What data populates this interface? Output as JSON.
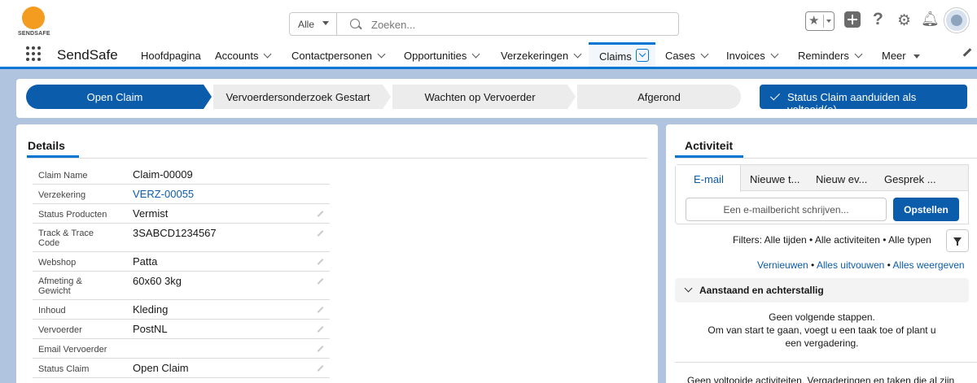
{
  "header": {
    "logo_text": "SENDSAFE",
    "search_scope": "Alle",
    "search_placeholder": "Zoeken..."
  },
  "nav": {
    "app_name": "SendSafe",
    "items": [
      {
        "label": "Hoofdpagina",
        "menu": false
      },
      {
        "label": "Accounts",
        "menu": true
      },
      {
        "label": "Contactpersonen",
        "menu": true
      },
      {
        "label": "Opportunities",
        "menu": true
      },
      {
        "label": "Verzekeringen",
        "menu": true
      },
      {
        "label": "Claims",
        "menu": true,
        "active": true
      },
      {
        "label": "Cases",
        "menu": true
      },
      {
        "label": "Invoices",
        "menu": true
      },
      {
        "label": "Reminders",
        "menu": true
      },
      {
        "label": "Meer",
        "menu": true
      }
    ]
  },
  "path": {
    "steps": [
      "Open Claim",
      "Vervoerdersonderzoek Gestart",
      "Wachten op Vervoerder",
      "Afgerond"
    ],
    "current_index": 0,
    "mark_button": "Status Claim aanduiden als voltooid(e)"
  },
  "details": {
    "tab": "Details",
    "fields": [
      {
        "label": "Claim Name",
        "value": "Claim-00009",
        "editable": false,
        "link": false
      },
      {
        "label": "Verzekering",
        "value": "VERZ-00055",
        "editable": false,
        "link": true
      },
      {
        "label": "Status Producten",
        "value": "Vermist",
        "editable": true,
        "link": false
      },
      {
        "label": "Track & Trace Code",
        "value": "3SABCD1234567",
        "editable": true,
        "link": false
      },
      {
        "label": "Webshop",
        "value": "Patta",
        "editable": true,
        "link": false
      },
      {
        "label": "Afmeting & Gewicht",
        "value": "60x60 3kg",
        "editable": true,
        "link": false
      },
      {
        "label": "Inhoud",
        "value": "Kleding",
        "editable": true,
        "link": false
      },
      {
        "label": "Vervoerder",
        "value": "PostNL",
        "editable": true,
        "link": false
      },
      {
        "label": "Email Vervoerder",
        "value": "",
        "editable": true,
        "link": false
      },
      {
        "label": "Status Claim",
        "value": "Open Claim",
        "editable": true,
        "link": false
      }
    ]
  },
  "activity": {
    "title": "Activiteit",
    "tabs": [
      "E-mail",
      "Nieuwe t...",
      "Nieuw ev...",
      "Gesprek ..."
    ],
    "email_placeholder": "Een e-mailbericht schrijven...",
    "compose_button": "Opstellen",
    "filters": "Filters: Alle tijden • Alle activiteiten • Alle typen",
    "links": [
      "Vernieuwen",
      "Alles uitvouwen",
      "Alles weergeven"
    ],
    "link_sep": " • ",
    "section_title": "Aanstaand en achterstallig",
    "upcoming_line1": "Geen volgende stappen.",
    "upcoming_line2": "Om van start te gaan, voegt u een taak toe of plant u een vergadering.",
    "done_text": "Geen voltooide activiteiten. Vergaderingen en taken die al zijn"
  }
}
